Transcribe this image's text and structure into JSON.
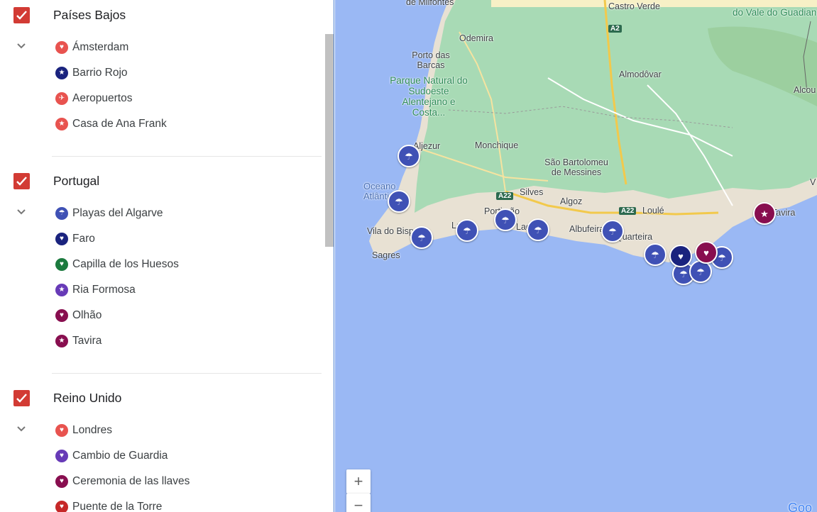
{
  "layers": [
    {
      "title": "Países Bajos",
      "items": [
        {
          "label": "Ámsterdam",
          "color": "#e8534f",
          "glyph": "♥"
        },
        {
          "label": "Barrio Rojo",
          "color": "#1a237e",
          "glyph": "★"
        },
        {
          "label": "Aeropuertos",
          "color": "#e8534f",
          "glyph": "✈"
        },
        {
          "label": "Casa de Ana Frank",
          "color": "#e8534f",
          "glyph": "★"
        }
      ]
    },
    {
      "title": "Portugal",
      "items": [
        {
          "label": "Playas del Algarve",
          "color": "#3f51b5",
          "glyph": "☂"
        },
        {
          "label": "Faro",
          "color": "#1a237e",
          "glyph": "♥"
        },
        {
          "label": "Capilla de los Huesos",
          "color": "#1b7a3e",
          "glyph": "♥"
        },
        {
          "label": "Ria Formosa",
          "color": "#673ab7",
          "glyph": "★"
        },
        {
          "label": "Olhão",
          "color": "#880e4f",
          "glyph": "♥"
        },
        {
          "label": "Tavira",
          "color": "#880e4f",
          "glyph": "★"
        }
      ]
    },
    {
      "title": "Reino Unido",
      "items": [
        {
          "label": "Londres",
          "color": "#e8534f",
          "glyph": "♥"
        },
        {
          "label": "Cambio de Guardia",
          "color": "#673ab7",
          "glyph": "♥"
        },
        {
          "label": "Ceremonia de las llaves",
          "color": "#880e4f",
          "glyph": "♥"
        },
        {
          "label": "Puente de la Torre",
          "color": "#c62828",
          "glyph": "♥"
        }
      ]
    }
  ],
  "map": {
    "places": [
      "de Milfontes",
      "Castro Verde",
      "do Vale do Guadiana",
      "Odemira",
      "Porto das Barcas",
      "Almodôvar",
      "Alcou",
      "Aljezur",
      "Monchique",
      "São Bartolomeu de Messines",
      "Oceano Atlântico",
      "Silves",
      "Algoz",
      "Loulé",
      "Portimão",
      "Lagos",
      "Lagoa",
      "Albufeira",
      "Quarteira",
      "Vila do Bispo",
      "Sagres",
      "Tavira",
      "V"
    ],
    "park": "Parque Natural do Sudoeste Alentejano e Costa...",
    "roads": [
      "A2",
      "A22",
      "A22"
    ],
    "zoom_in": "+",
    "zoom_out": "−",
    "google": "Goo"
  }
}
